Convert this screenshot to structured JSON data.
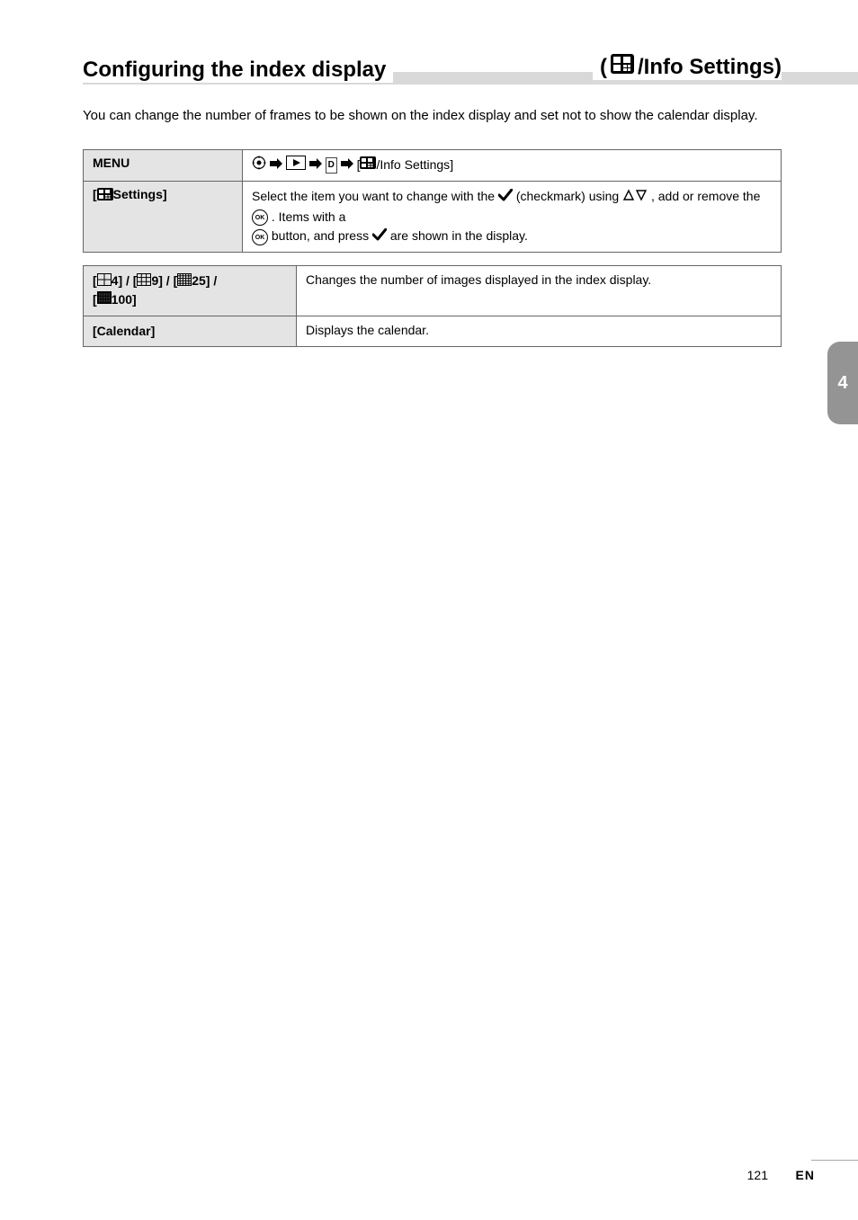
{
  "heading": {
    "left": "Configuring the index display",
    "right_prefix": "(",
    "right_label": "/Info Settings)"
  },
  "intro": "You can change the number of frames to be shown on the index display and set not to show the calendar display.",
  "nav": {
    "menu_label": "MENU",
    "tab_label_d": "D",
    "tab_label_q": "q",
    "settings_name": "/Info Settings",
    "row2_part1": "Select the item you want to change with the ",
    "row2_part2": "(checkmark) using ",
    "row2_part3": ", add or remove the ",
    "row2_part4": ". Items with a ",
    "row2_part5": " button, and press ",
    "row2_part6": " are shown in the display."
  },
  "options": {
    "settings_label": "Settings",
    "row1_vals": "4] / [",
    "row1_vals2": "9] / [",
    "row1_vals3": "25] / ",
    "row1_vals4": "100]",
    "row1_prefix": "[",
    "row1_desc": "Changes the number of images displayed in the index display.",
    "row2_label": "[Calendar]",
    "row2_desc": "Displays the calendar."
  },
  "sidebar": {
    "num": "4"
  },
  "footer": {
    "page": "121",
    "lang": "EN"
  }
}
